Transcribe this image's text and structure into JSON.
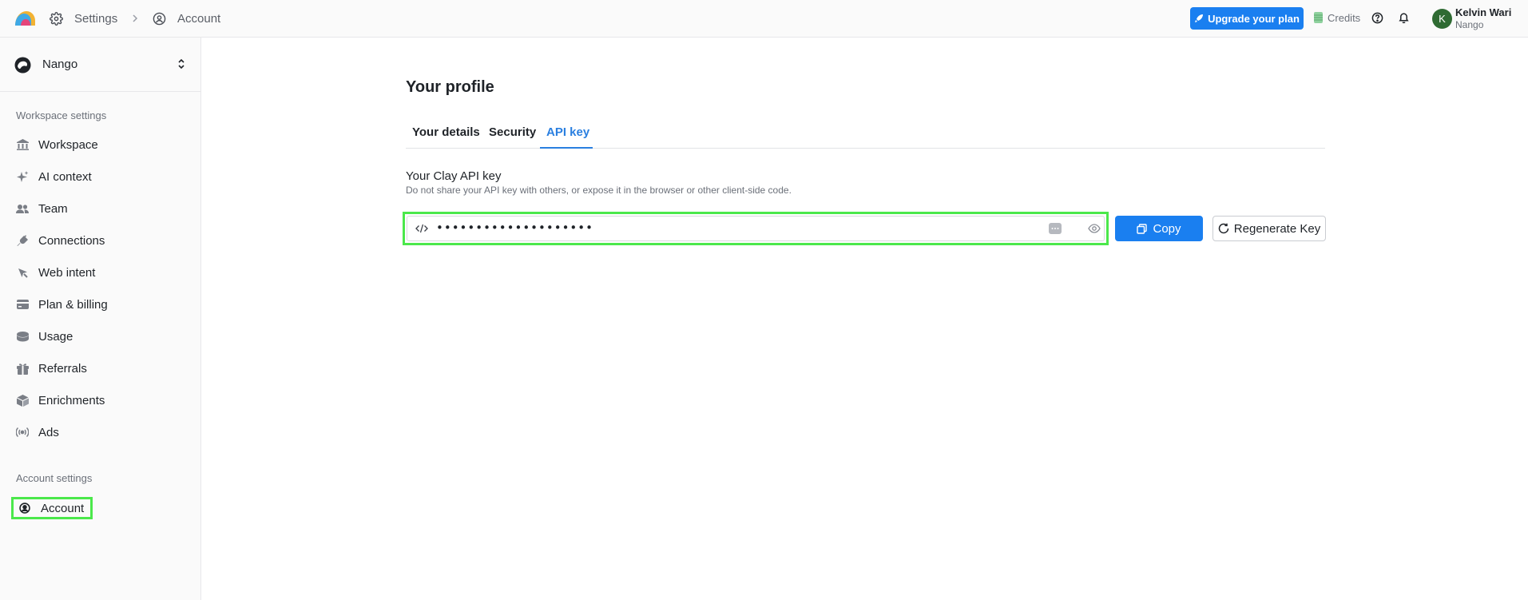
{
  "breadcrumb": {
    "settings": "Settings",
    "account": "Account"
  },
  "topbar": {
    "upgrade_label": "Upgrade your plan",
    "credits_label": "Credits",
    "user_initial": "K",
    "user_name": "Kelvin Wari",
    "user_org": "Nango"
  },
  "sidebar": {
    "workspace_name": "Nango",
    "workspace_section": "Workspace settings",
    "items": [
      {
        "label": "Workspace",
        "icon": "building-icon"
      },
      {
        "label": "AI context",
        "icon": "sparkle-icon"
      },
      {
        "label": "Team",
        "icon": "users-icon"
      },
      {
        "label": "Connections",
        "icon": "plug-icon"
      },
      {
        "label": "Web intent",
        "icon": "cursor-icon"
      },
      {
        "label": "Plan & billing",
        "icon": "card-icon"
      },
      {
        "label": "Usage",
        "icon": "database-icon"
      },
      {
        "label": "Referrals",
        "icon": "gift-icon"
      },
      {
        "label": "Enrichments",
        "icon": "cube-icon"
      },
      {
        "label": "Ads",
        "icon": "broadcast-icon"
      }
    ],
    "account_section": "Account settings",
    "account_item": "Account"
  },
  "main": {
    "title": "Your profile",
    "tabs": [
      "Your details",
      "Security",
      "API key"
    ],
    "active_tab": "API key",
    "key_title": "Your Clay API key",
    "key_description": "Do not share your API key with others, or expose it in the browser or other client-side code.",
    "key_value": "••••••••••••••••••••",
    "copy_label": "Copy",
    "regenerate_label": "Regenerate Key"
  },
  "colors": {
    "accent": "#1a7ff0",
    "highlight": "#4be84b"
  }
}
